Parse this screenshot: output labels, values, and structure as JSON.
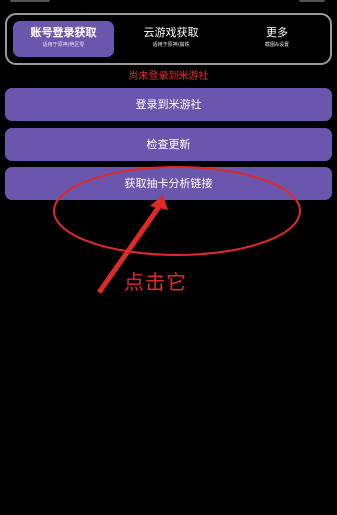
{
  "tabs": [
    {
      "title": "账号登录获取",
      "subtitle": "适用于原神/绝区零",
      "active": true
    },
    {
      "title": "云游戏获取",
      "subtitle": "适用于原神/崩铁",
      "active": false
    },
    {
      "title": "更多",
      "subtitle": "截图&设置",
      "active": false
    }
  ],
  "status": {
    "text": "尚未登录到米游社",
    "color": "#e02a2a"
  },
  "buttons": {
    "login_label": "登录到米游社",
    "update_label": "检查更新",
    "fetch_link_label": "获取抽卡分析链接"
  },
  "annotation": {
    "text": "点击它",
    "color": "#e02a2a"
  },
  "colors": {
    "accent": "#6b56ad",
    "background": "#000000",
    "tab_border": "#9a9a9a"
  }
}
